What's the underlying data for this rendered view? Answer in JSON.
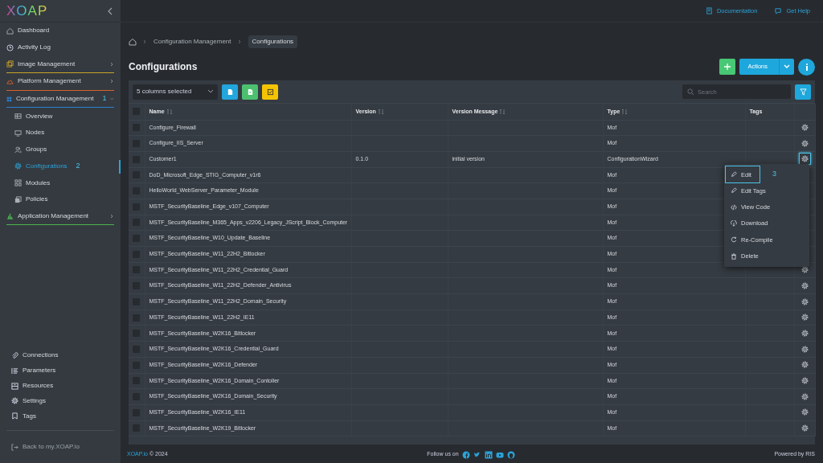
{
  "logo": "XOAP",
  "sidebar": {
    "items": [
      {
        "label": "Dashboard",
        "selected": false
      },
      {
        "label": "Activity Log",
        "selected": false
      },
      {
        "label": "Image Management",
        "selected": false,
        "expanded": false,
        "color": "#c9a227"
      },
      {
        "label": "Platform Management",
        "selected": false,
        "expanded": false,
        "color": "#d9622b"
      },
      {
        "label": "Configuration Management",
        "selected": false,
        "expanded": true,
        "color": "#2f7fd0",
        "marker": "1",
        "children": [
          {
            "label": "Overview",
            "selected": false
          },
          {
            "label": "Nodes",
            "selected": false
          },
          {
            "label": "Groups",
            "selected": false
          },
          {
            "label": "Configurations",
            "selected": true,
            "marker": "2"
          },
          {
            "label": "Modules",
            "selected": false
          },
          {
            "label": "Policies",
            "selected": false
          }
        ]
      },
      {
        "label": "Application Management",
        "selected": false,
        "expanded": false,
        "color": "#4caf50"
      }
    ],
    "bottom_items": [
      {
        "label": "Connections"
      },
      {
        "label": "Parameters"
      },
      {
        "label": "Resources"
      },
      {
        "label": "Settings"
      },
      {
        "label": "Tags"
      }
    ],
    "back_link": "Back to my.XOAP.io"
  },
  "topbar": {
    "links": [
      "Documentation",
      "Get Help"
    ]
  },
  "breadcrumb": [
    "Configuration Management",
    "Configurations"
  ],
  "page_title": "Configurations",
  "header_buttons": {
    "actions": "Actions"
  },
  "toolbar": {
    "columns_select": "5 columns selected",
    "search_placeholder": "Search"
  },
  "table": {
    "select_all_checked": false,
    "columns": [
      {
        "label": "Name",
        "sortable": true
      },
      {
        "label": "Version",
        "sortable": true
      },
      {
        "label": "Version Message",
        "sortable": true
      },
      {
        "label": "Type",
        "sortable": true
      },
      {
        "label": "Tags",
        "sortable": false
      }
    ],
    "rows": [
      {
        "name": "Configure_Firewall",
        "version": "",
        "version_message": "",
        "type": "Mof",
        "checked": false,
        "settings_icon": true,
        "focused": false
      },
      {
        "name": "Configure_IIS_Server",
        "version": "",
        "version_message": "",
        "type": "Mof",
        "checked": false,
        "settings_icon": true,
        "focused": false
      },
      {
        "name": "Customer1",
        "version": "0.1.0",
        "version_message": "initial version",
        "type": "ConfigurationWizard",
        "checked": false,
        "settings_icon": true,
        "focused": true
      },
      {
        "name": "DoD_Microsoft_Edge_STIG_Computer_v1r6",
        "version": "",
        "version_message": "",
        "type": "Mof",
        "checked": false
      },
      {
        "name": "HelloWorld_WebServer_Parameter_Module",
        "version": "",
        "version_message": "",
        "type": "Mof",
        "checked": false
      },
      {
        "name": "MSTF_SecurityBaseline_Edge_v107_Computer",
        "version": "",
        "version_message": "",
        "type": "Mof",
        "checked": false
      },
      {
        "name": "MSTF_SecurityBaseline_M365_Apps_v2206_Legacy_JScript_Block_Computer",
        "version": "",
        "version_message": "",
        "type": "Mof",
        "checked": false
      },
      {
        "name": "MSTF_SecurityBaseline_W10_Update_Baseline",
        "version": "",
        "version_message": "",
        "type": "Mof",
        "checked": false
      },
      {
        "name": "MSTF_SecurityBaseline_W11_22H2_Bitlocker",
        "version": "",
        "version_message": "",
        "type": "Mof",
        "checked": false
      },
      {
        "name": "MSTF_SecurityBaseline_W11_22H2_Credential_Guard",
        "version": "",
        "version_message": "",
        "type": "Mof",
        "checked": false,
        "settings_icon": true,
        "focused": false
      },
      {
        "name": "MSTF_SecurityBaseline_W11_22H2_Defender_Antivirus",
        "version": "",
        "version_message": "",
        "type": "Mof",
        "checked": false,
        "settings_icon": true,
        "focused": false
      },
      {
        "name": "MSTF_SecurityBaseline_W11_22H2_Domain_Security",
        "version": "",
        "version_message": "",
        "type": "Mof",
        "checked": false,
        "settings_icon": true,
        "focused": false
      },
      {
        "name": "MSTF_SecurityBaseline_W11_22H2_IE11",
        "version": "",
        "version_message": "",
        "type": "Mof",
        "checked": false,
        "settings_icon": true,
        "focused": false
      },
      {
        "name": "MSTF_SecurityBaseline_W2K16_Bitlocker",
        "version": "",
        "version_message": "",
        "type": "Mof",
        "checked": false,
        "settings_icon": true,
        "focused": false
      },
      {
        "name": "MSTF_SecurityBaseline_W2K16_Credential_Guard",
        "version": "",
        "version_message": "",
        "type": "Mof",
        "checked": false,
        "settings_icon": true,
        "focused": false
      },
      {
        "name": "MSTF_SecurityBaseline_W2K16_Defender",
        "version": "",
        "version_message": "",
        "type": "Mof",
        "checked": false,
        "settings_icon": true,
        "focused": false
      },
      {
        "name": "MSTF_SecurityBaseline_W2K16_Domain_Contoller",
        "version": "",
        "version_message": "",
        "type": "Mof",
        "checked": false,
        "settings_icon": true,
        "focused": false
      },
      {
        "name": "MSTF_SecurityBaseline_W2K16_Domain_Security",
        "version": "",
        "version_message": "",
        "type": "Mof",
        "checked": false,
        "settings_icon": true,
        "focused": false
      },
      {
        "name": "MSTF_SecurityBaseline_W2K16_IE11",
        "version": "",
        "version_message": "",
        "type": "Mof",
        "checked": false,
        "settings_icon": true,
        "focused": false
      },
      {
        "name": "MSTF_SecurityBaseline_W2K19_Bitlocker",
        "version": "",
        "version_message": "",
        "type": "Mof",
        "checked": false,
        "settings_icon": true,
        "focused": false
      }
    ]
  },
  "context_menu": {
    "items": [
      {
        "label": "Edit",
        "focused": true,
        "marker": "3"
      },
      {
        "label": "Edit Tags",
        "focused": false
      },
      {
        "label": "View Code",
        "focused": false
      },
      {
        "label": "Download",
        "focused": false
      },
      {
        "label": "Re-Compile",
        "focused": false
      },
      {
        "label": "Delete",
        "focused": false
      }
    ]
  },
  "footer": {
    "brand_link": "XOAP.io",
    "copyright": "© 2024",
    "follow": "Follow us on",
    "powered": "Powered by RIS"
  }
}
